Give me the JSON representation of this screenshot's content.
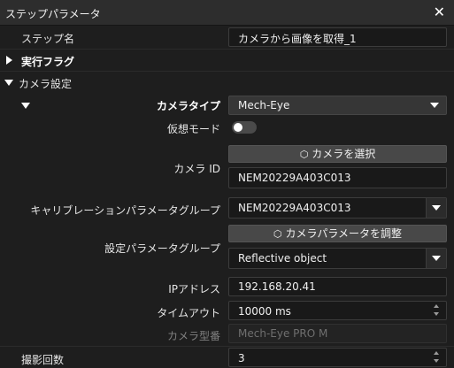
{
  "window": {
    "title": "ステップパラメータ",
    "close_glyph": "✕"
  },
  "step_name": {
    "label": "ステップ名",
    "value": "カメラから画像を取得_1"
  },
  "exec_flag": {
    "label": "実行フラグ"
  },
  "camera_settings": {
    "label": "カメラ設定",
    "camera_type": {
      "label": "カメラタイプ",
      "value": "Mech-Eye"
    },
    "virtual_mode": {
      "label": "仮想モード",
      "state": "off"
    },
    "select_camera_button": {
      "icon": "gear-hex-icon",
      "label": "カメラを選択"
    },
    "camera_id": {
      "label": "カメラ ID",
      "value": "NEM20229A403C013"
    },
    "calibration_group": {
      "label": "キャリブレーションパラメータグループ",
      "value": "NEM20229A403C013"
    },
    "adjust_params_button": {
      "icon": "gear-hex-icon",
      "label": "カメラパラメータを調整"
    },
    "config_group": {
      "label": "設定パラメータグループ",
      "value": "Reflective object"
    },
    "ip_address": {
      "label": "IPアドレス",
      "value": "192.168.20.41"
    },
    "timeout": {
      "label": "タイムアウト",
      "value": "10000 ms"
    },
    "camera_model": {
      "label": "カメラ型番",
      "value": "Mech-Eye PRO M"
    }
  },
  "capture_count": {
    "label": "撮影回数",
    "value": "3"
  }
}
